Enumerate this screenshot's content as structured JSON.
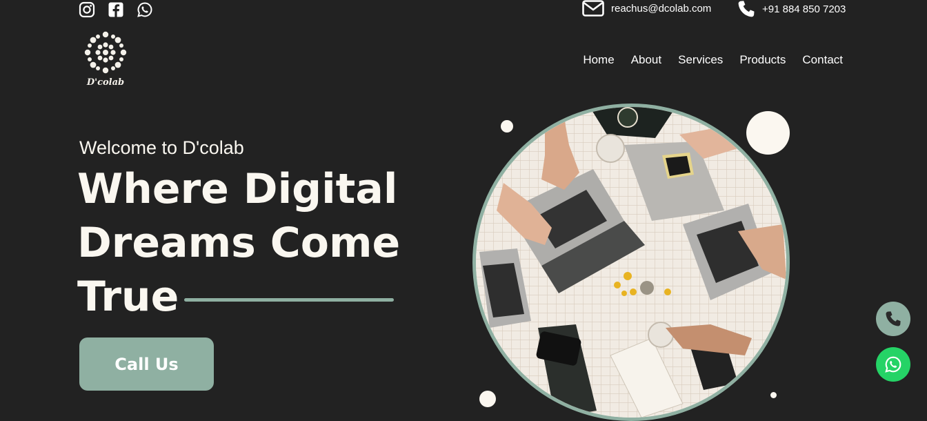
{
  "social": [
    {
      "name": "instagram",
      "icon": "instagram-icon"
    },
    {
      "name": "facebook",
      "icon": "facebook-icon"
    },
    {
      "name": "whatsapp",
      "icon": "whatsapp-icon"
    }
  ],
  "contact": {
    "email": "reachus@dcolab.com",
    "email_icon": "envelope-icon",
    "phone": "+91 884 850 7203",
    "phone_icon": "phone-icon"
  },
  "logo": {
    "text": "D'colab"
  },
  "nav": {
    "items": [
      "Home",
      "About",
      "Services",
      "Products",
      "Contact"
    ]
  },
  "hero": {
    "welcome": "Welcome to D'colab",
    "headline_lines": [
      "Where Digital",
      "Dreams Come",
      "True"
    ],
    "cta_label": "Call Us",
    "image_subject": "overhead view of team working with laptops and phones on a tiled table"
  },
  "colors": {
    "background": "#222222",
    "accent": "#8fb0a2",
    "text": "#faf7f0",
    "whatsapp": "#25d366",
    "call_fab": "#8fb0a2"
  },
  "floating": {
    "call_icon": "phone-icon",
    "whatsapp_icon": "whatsapp-icon"
  }
}
